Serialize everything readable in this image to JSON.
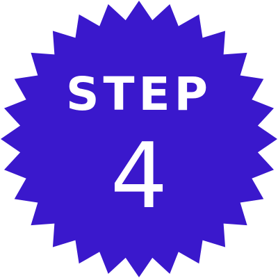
{
  "badge": {
    "label": "STEP",
    "number": "4",
    "fill_color": "#3A18CC",
    "text_color": "#FFFFFF",
    "shape": "starburst-seal"
  }
}
